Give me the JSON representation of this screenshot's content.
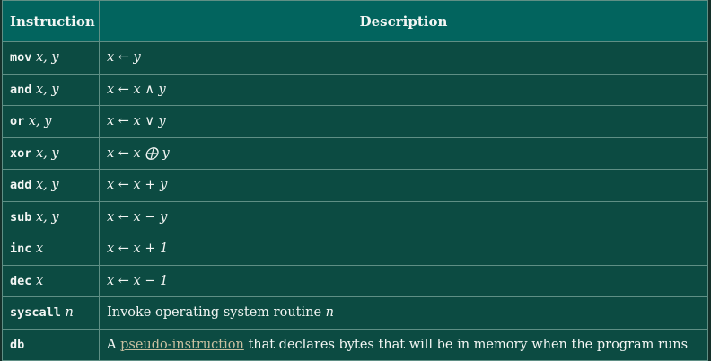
{
  "table": {
    "headers": [
      "Instruction",
      "Description"
    ],
    "rows": [
      {
        "mnemonic": "mov",
        "operands": "x, y",
        "description_math": "x ← y"
      },
      {
        "mnemonic": "and",
        "operands": "x, y",
        "description_math": "x ← x ∧ y"
      },
      {
        "mnemonic": "or",
        "operands": "x, y",
        "description_math": "x ← x ∨ y"
      },
      {
        "mnemonic": "xor",
        "operands": "x, y",
        "description_math": "x ← x ⨁ y"
      },
      {
        "mnemonic": "add",
        "operands": "x, y",
        "description_math": "x ← x + y"
      },
      {
        "mnemonic": "sub",
        "operands": "x, y",
        "description_math": "x ← x − y"
      },
      {
        "mnemonic": "inc",
        "operands": "x",
        "description_math": "x ← x + 1"
      },
      {
        "mnemonic": "dec",
        "operands": "x",
        "description_math": "x ← x − 1"
      },
      {
        "mnemonic": "syscall",
        "operands": "n",
        "description_text": "Invoke operating system routine",
        "description_math_suffix": "n"
      },
      {
        "mnemonic": "db",
        "operands": "",
        "description_prefix": "A",
        "description_link": "pseudo-instruction",
        "description_text": "that declares bytes that will be in memory when the program runs"
      }
    ]
  },
  "colors": {
    "header_bg": "#02645e",
    "cell_bg": "#0c4b42",
    "border": "#5f8f85",
    "text": "#f3f6f4",
    "link": "#c9bfa0"
  }
}
